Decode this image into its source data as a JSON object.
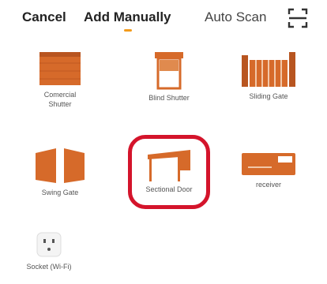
{
  "header": {
    "cancel_label": "Cancel",
    "tabs": [
      {
        "label": "Add Manually",
        "active": true
      },
      {
        "label": "Auto Scan",
        "active": false
      }
    ],
    "scan_icon": "qr-scan-icon"
  },
  "devices": [
    {
      "label": "Comercial Shutter",
      "icon": "commercial-shutter-icon"
    },
    {
      "label": "Blind Shutter",
      "icon": "blind-shutter-icon"
    },
    {
      "label": "Sliding Gate",
      "icon": "sliding-gate-icon"
    },
    {
      "label": "Swing Gate",
      "icon": "swing-gate-icon"
    },
    {
      "label": "Sectional Door",
      "icon": "sectional-door-icon",
      "highlighted": true
    },
    {
      "label": "receiver",
      "icon": "receiver-icon"
    },
    {
      "label": "Socket (Wi-Fi)",
      "icon": "socket-icon"
    }
  ],
  "colors": {
    "accent": "#f39b1c",
    "device": "#d66a2a",
    "highlight": "#d4142b"
  }
}
